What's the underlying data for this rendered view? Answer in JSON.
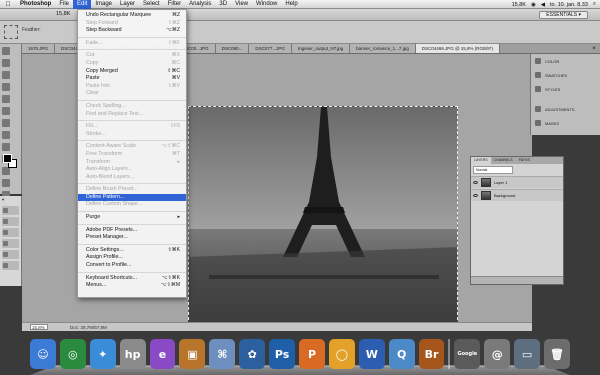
{
  "menubar": {
    "apple": "",
    "items": [
      "Photoshop",
      "File",
      "Edit",
      "Image",
      "Layer",
      "Select",
      "Filter",
      "Analysis",
      "3D",
      "View",
      "Window",
      "Help"
    ],
    "active_index": 2,
    "status": {
      "datetime": "to. 10. jan.  8.33",
      "zoom_indicator": "15,8K"
    }
  },
  "options_bar": {
    "feather_label": "Feather:",
    "workspace": "ESSENTIALS ▾"
  },
  "tabs": [
    "1670.JPG",
    "DSC044...",
    "IMG_...",
    "49.jpg",
    "DSC040...",
    "DSC03...JPG",
    "DSC090...",
    "DSC077...JPG",
    "Ingeser_output_NT.jpg",
    "banner_romance_1...7.jpg",
    "DSC04469.JPG @ 15,8% (RGB/8*)"
  ],
  "active_tab_index": 10,
  "edit_menu": {
    "rows": [
      {
        "label": "Undo Rectangular Marquee",
        "shortcut": "⌘Z",
        "disabled": false
      },
      {
        "label": "Step Forward",
        "shortcut": "⇧⌘Z",
        "disabled": true
      },
      {
        "label": "Step Backward",
        "shortcut": "⌥⌘Z",
        "disabled": false
      },
      {
        "sep": true
      },
      {
        "label": "Fade...",
        "shortcut": "⇧⌘F",
        "disabled": true
      },
      {
        "sep": true
      },
      {
        "label": "Cut",
        "shortcut": "⌘X",
        "disabled": true
      },
      {
        "label": "Copy",
        "shortcut": "⌘C",
        "disabled": true
      },
      {
        "label": "Copy Merged",
        "shortcut": "⇧⌘C",
        "disabled": false
      },
      {
        "label": "Paste",
        "shortcut": "⌘V",
        "disabled": false
      },
      {
        "label": "Paste Into",
        "shortcut": "⇧⌘V",
        "disabled": true
      },
      {
        "label": "Clear",
        "shortcut": "",
        "disabled": true
      },
      {
        "sep": true
      },
      {
        "label": "Check Spelling...",
        "shortcut": "",
        "disabled": true
      },
      {
        "label": "Find and Replace Text...",
        "shortcut": "",
        "disabled": true
      },
      {
        "sep": true
      },
      {
        "label": "Fill...",
        "shortcut": "⇧F5",
        "disabled": true
      },
      {
        "label": "Stroke...",
        "shortcut": "",
        "disabled": true
      },
      {
        "sep": true
      },
      {
        "label": "Content-Aware Scale",
        "shortcut": "⌥⇧⌘C",
        "disabled": true
      },
      {
        "label": "Free Transform",
        "shortcut": "⌘T",
        "disabled": true
      },
      {
        "label": "Transform",
        "shortcut": "▸",
        "disabled": true
      },
      {
        "label": "Auto-Align Layers...",
        "shortcut": "",
        "disabled": true
      },
      {
        "label": "Auto-Blend Layers...",
        "shortcut": "",
        "disabled": true
      },
      {
        "sep": true
      },
      {
        "label": "Define Brush Preset...",
        "shortcut": "",
        "disabled": true
      },
      {
        "label": "Define Pattern...",
        "shortcut": "",
        "disabled": false,
        "highlight": true
      },
      {
        "label": "Define Custom Shape...",
        "shortcut": "",
        "disabled": true
      },
      {
        "sep": true
      },
      {
        "label": "Purge",
        "shortcut": "▸",
        "disabled": false
      },
      {
        "sep": true
      },
      {
        "label": "Adobe PDF Presets...",
        "shortcut": "",
        "disabled": false
      },
      {
        "label": "Preset Manager...",
        "shortcut": "",
        "disabled": false
      },
      {
        "sep": true
      },
      {
        "label": "Color Settings...",
        "shortcut": "⇧⌘K",
        "disabled": false
      },
      {
        "label": "Assign Profile...",
        "shortcut": "",
        "disabled": false
      },
      {
        "label": "Convert to Profile...",
        "shortcut": "",
        "disabled": false
      },
      {
        "sep": true
      },
      {
        "label": "Keyboard Shortcuts...",
        "shortcut": "⌥⇧⌘K",
        "disabled": false
      },
      {
        "label": "Menus...",
        "shortcut": "⌥⇧⌘M",
        "disabled": false
      }
    ]
  },
  "dock_panel": {
    "items": [
      "COLOR",
      "SWATCHES",
      "STYLES",
      "ADJUSTMENTS",
      "MASKS"
    ]
  },
  "layers_panel": {
    "tabs": [
      "LAYERS",
      "CHANNELS",
      "PATHS"
    ],
    "blend_mode": "Normal",
    "layers": [
      "Layer 1",
      "Background"
    ]
  },
  "status_bar": {
    "zoom": "15,8%",
    "doc_size": "Doc: 28,7M/57,9M"
  },
  "dock_icons": [
    {
      "name": "finder-icon",
      "glyph": "☺",
      "color": "#3b7bd6"
    },
    {
      "name": "network-icon",
      "glyph": "◎",
      "color": "#2a8a3d"
    },
    {
      "name": "safari-icon",
      "glyph": "✦",
      "color": "#3a8bd8"
    },
    {
      "name": "hp-icon",
      "glyph": "hp",
      "color": "#8a8a8a"
    },
    {
      "name": "messenger-icon",
      "glyph": "e",
      "color": "#8a4ac6"
    },
    {
      "name": "photo-icon",
      "glyph": "▣",
      "color": "#b8742a"
    },
    {
      "name": "preview-icon",
      "glyph": "⌘",
      "color": "#6c8fbf"
    },
    {
      "name": "imageviewer-icon",
      "glyph": "✿",
      "color": "#2c5f9e"
    },
    {
      "name": "photoshop-icon",
      "glyph": "Ps",
      "color": "#1f5fa8"
    },
    {
      "name": "powerpoint-icon",
      "glyph": "P",
      "color": "#d86a23"
    },
    {
      "name": "office-icon",
      "glyph": "◯",
      "color": "#e4a12a"
    },
    {
      "name": "word-icon",
      "glyph": "W",
      "color": "#2d5db0"
    },
    {
      "name": "quicktime-icon",
      "glyph": "Q",
      "color": "#4b89c7"
    },
    {
      "name": "bridge-icon",
      "glyph": "Br",
      "color": "#a6551b"
    },
    {
      "name": "google-icon",
      "glyph": "Google",
      "color": "#5a5a5a"
    },
    {
      "name": "mail-icon",
      "glyph": "@",
      "color": "#7a7a7a"
    },
    {
      "name": "screen-icon",
      "glyph": "▭",
      "color": "#5d6e80"
    },
    {
      "name": "trash-icon",
      "glyph": "🗑",
      "color": "#6c6c6c"
    }
  ]
}
